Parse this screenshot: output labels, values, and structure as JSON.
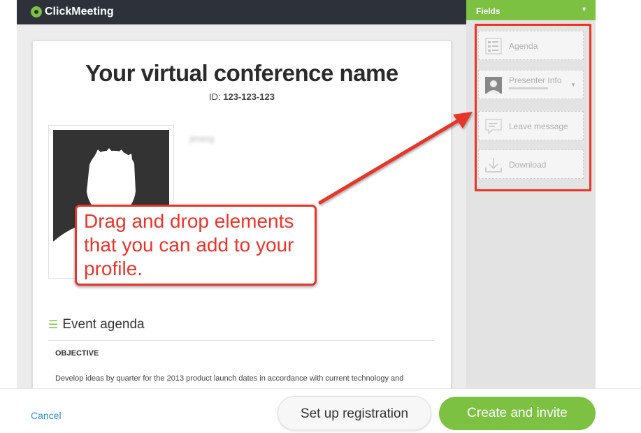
{
  "header": {
    "app_name": "ClickMeeting"
  },
  "conference": {
    "title": "Your virtual conference name",
    "id_label": "ID:",
    "id_value": "123-123-123",
    "presenter_name": "jimerg"
  },
  "agenda": {
    "heading": "Event agenda",
    "objective_label": "OBJECTIVE",
    "text": "Develop ideas by quarter for the 2013 product launch dates in accordance with current technology and marketing platforms. Everyone should be prepared to discuss and offer"
  },
  "fields_panel": {
    "title": "Fields",
    "items": [
      {
        "label": "Agenda",
        "icon": "agenda-icon"
      },
      {
        "label": "Presenter Info",
        "icon": "presenter-icon"
      },
      {
        "label": "Leave message",
        "icon": "message-icon"
      },
      {
        "label": "Download",
        "icon": "download-icon"
      }
    ]
  },
  "callout": {
    "text": "Drag and drop elements that you can add to your profile."
  },
  "footer": {
    "cancel_label": "Cancel",
    "setup_label": "Set up registration",
    "create_label": "Create and invite"
  },
  "colors": {
    "accent": "#7cc142",
    "annotation": "#e8352b",
    "header_bg": "#2d313a",
    "link": "#2b8dd8"
  }
}
